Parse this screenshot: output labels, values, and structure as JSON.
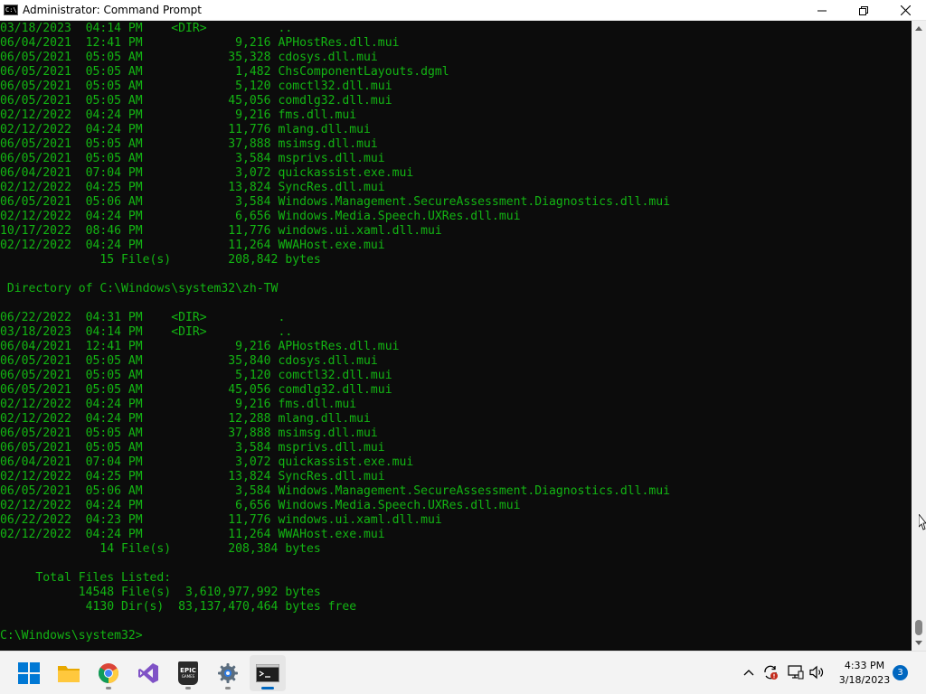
{
  "window": {
    "title": "Administrator:  Command Prompt",
    "minimize": "—",
    "restore": "❐",
    "close": "✕"
  },
  "console": {
    "lines": [
      "03/18/2023  04:14 PM    <DIR>          ..",
      "06/04/2021  12:41 PM             9,216 APHostRes.dll.mui",
      "06/05/2021  05:05 AM            35,328 cdosys.dll.mui",
      "06/05/2021  05:05 AM             1,482 ChsComponentLayouts.dgml",
      "06/05/2021  05:05 AM             5,120 comctl32.dll.mui",
      "06/05/2021  05:05 AM            45,056 comdlg32.dll.mui",
      "02/12/2022  04:24 PM             9,216 fms.dll.mui",
      "02/12/2022  04:24 PM            11,776 mlang.dll.mui",
      "06/05/2021  05:05 AM            37,888 msimsg.dll.mui",
      "06/05/2021  05:05 AM             3,584 msprivs.dll.mui",
      "06/04/2021  07:04 PM             3,072 quickassist.exe.mui",
      "02/12/2022  04:25 PM            13,824 SyncRes.dll.mui",
      "06/05/2021  05:06 AM             3,584 Windows.Management.SecureAssessment.Diagnostics.dll.mui",
      "02/12/2022  04:24 PM             6,656 Windows.Media.Speech.UXRes.dll.mui",
      "10/17/2022  08:46 PM            11,776 windows.ui.xaml.dll.mui",
      "02/12/2022  04:24 PM            11,264 WWAHost.exe.mui",
      "              15 File(s)        208,842 bytes",
      "",
      " Directory of C:\\Windows\\system32\\zh-TW",
      "",
      "06/22/2022  04:31 PM    <DIR>          .",
      "03/18/2023  04:14 PM    <DIR>          ..",
      "06/04/2021  12:41 PM             9,216 APHostRes.dll.mui",
      "06/05/2021  05:05 AM            35,840 cdosys.dll.mui",
      "06/05/2021  05:05 AM             5,120 comctl32.dll.mui",
      "06/05/2021  05:05 AM            45,056 comdlg32.dll.mui",
      "02/12/2022  04:24 PM             9,216 fms.dll.mui",
      "02/12/2022  04:24 PM            12,288 mlang.dll.mui",
      "06/05/2021  05:05 AM            37,888 msimsg.dll.mui",
      "06/05/2021  05:05 AM             3,584 msprivs.dll.mui",
      "06/04/2021  07:04 PM             3,072 quickassist.exe.mui",
      "02/12/2022  04:25 PM            13,824 SyncRes.dll.mui",
      "06/05/2021  05:06 AM             3,584 Windows.Management.SecureAssessment.Diagnostics.dll.mui",
      "02/12/2022  04:24 PM             6,656 Windows.Media.Speech.UXRes.dll.mui",
      "06/22/2022  04:23 PM            11,776 windows.ui.xaml.dll.mui",
      "02/12/2022  04:24 PM            11,264 WWAHost.exe.mui",
      "              14 File(s)        208,384 bytes",
      "",
      "     Total Files Listed:",
      "           14548 File(s)  3,610,977,992 bytes",
      "            4130 Dir(s)  83,137,470,464 bytes free",
      "",
      "C:\\Windows\\system32>"
    ]
  },
  "colors": {
    "console_text": "#13b513",
    "console_bg": "#0c0c0c",
    "accent": "#0067c0"
  },
  "taskbar": {
    "apps": [
      {
        "name": "start",
        "icon": "windows-logo-icon",
        "running": false
      },
      {
        "name": "file-explorer",
        "icon": "folder-icon",
        "running": false
      },
      {
        "name": "chrome",
        "icon": "chrome-icon",
        "running": true
      },
      {
        "name": "visual-studio",
        "icon": "visual-studio-icon",
        "running": false
      },
      {
        "name": "epic-games",
        "icon": "epic-games-icon",
        "running": true
      },
      {
        "name": "settings",
        "icon": "gear-icon",
        "running": true
      },
      {
        "name": "command-prompt",
        "icon": "terminal-icon",
        "running": true,
        "active": true
      }
    ],
    "epic_label": "EPIC",
    "epic_sublabel": "GAMES",
    "clock": {
      "time": "4:33 PM",
      "date": "3/18/2023"
    },
    "notifications_count": "3"
  }
}
